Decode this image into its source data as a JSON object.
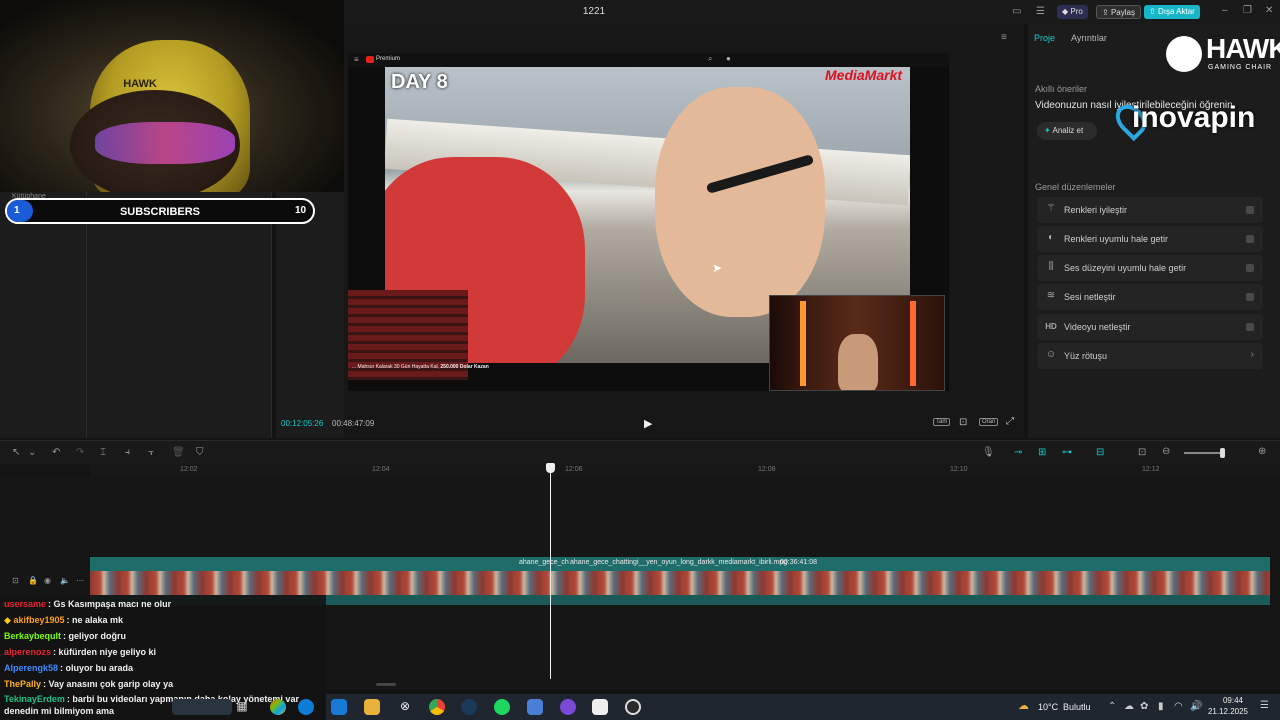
{
  "window": {
    "title": "1221"
  },
  "header": {
    "pro_label": "Pro",
    "share_label": "Paylaş",
    "export_label": "Dışa Aktar"
  },
  "webcam": {
    "chair_text": "HAWK"
  },
  "subscriber_bar": {
    "current": "1",
    "label": "SUBSCRIBERS",
    "goal": "10",
    "behind_text_1": "Kütüphane",
    "behind_text_2": "amina"
  },
  "preview": {
    "page_brand": "Premium",
    "day_overlay": "DAY 8",
    "video_brand": "MediaMarkt",
    "video_caption_prefix": "... Mahsur Kalarak 30 Gün Hayatta Kal, ",
    "video_caption_bold": "250.000 Dolar Kazan",
    "current_time": "00:12:05:26",
    "total_time": "00:48:47:09",
    "controls": [
      "Tam",
      "Oran"
    ]
  },
  "right_panel": {
    "tabs": [
      "Proje",
      "Ayrıntılar"
    ],
    "smart_title": "Akıllı öneriler",
    "smart_text": "Videonuzun nasıl iyileştirilebileceğini öğrenin",
    "analyze_label": "Analiz et",
    "general_title": "Genel düzenlemeler",
    "items": [
      {
        "label": "Renkleri iyileştir",
        "icon": "magic-wand-icon"
      },
      {
        "label": "Renkleri uyumlu hale getir",
        "icon": "color-match-icon"
      },
      {
        "label": "Ses düzeyini uyumlu hale getir",
        "icon": "audio-level-icon"
      },
      {
        "label": "Sesi netleştir",
        "icon": "audio-enhance-icon"
      },
      {
        "label": "Videoyu netleştir",
        "icon": "hd-icon"
      },
      {
        "label": "Yüz rötuşu",
        "icon": "face-retouch-icon"
      }
    ]
  },
  "overlay_logos": {
    "hawk": "HAWK",
    "hawk_sub": "GAMING CHAIR",
    "inova": "inovapin"
  },
  "timeline": {
    "ruler": [
      "12:02",
      "12:04",
      "12:06",
      "12:08",
      "12:10",
      "12:12"
    ],
    "clip_left": "ahane_gece_ch",
    "clip_main": "ahane_gece_chattingi__yen_oyun_long_darkk_mediamarkt_ibirli.mpg",
    "clip_duration": "00:36:41:08"
  },
  "chat": [
    {
      "user": "usersame",
      "color": "#e8232f",
      "msg": "Gs Kasımpaşa macı ne olur"
    },
    {
      "user": "akifbey1905",
      "color": "#ff9f1a",
      "msg": "ne alaka mk"
    },
    {
      "user": "Berkaybeqult",
      "color": "#7cfc00",
      "msg": "geliyor doğru"
    },
    {
      "user": "alperenozs",
      "color": "#e8232f",
      "msg": "küfürden niye geliyo ki"
    },
    {
      "user": "Alperengk58",
      "color": "#3d8bff",
      "msg": "oluyor bu arada"
    },
    {
      "user": "ThePally",
      "color": "#ffb020",
      "msg": "Vay anasını çok garip olay ya"
    },
    {
      "user": "TekinayErdem",
      "color": "#18c18c",
      "msg": "barbi bu videoları yapmanın daha kolay yönetemi var denedin mi bilmiyom ama"
    }
  ],
  "taskbar": {
    "weather_temp": "10°C",
    "weather_text": "Bulutlu",
    "clock_time": "09:44",
    "clock_date": "21.12.2025"
  },
  "colors": {
    "accent": "#19c7c7",
    "pro": "#3a3a6a",
    "export": "#19b6c9",
    "clip": "#1f6d6a"
  }
}
